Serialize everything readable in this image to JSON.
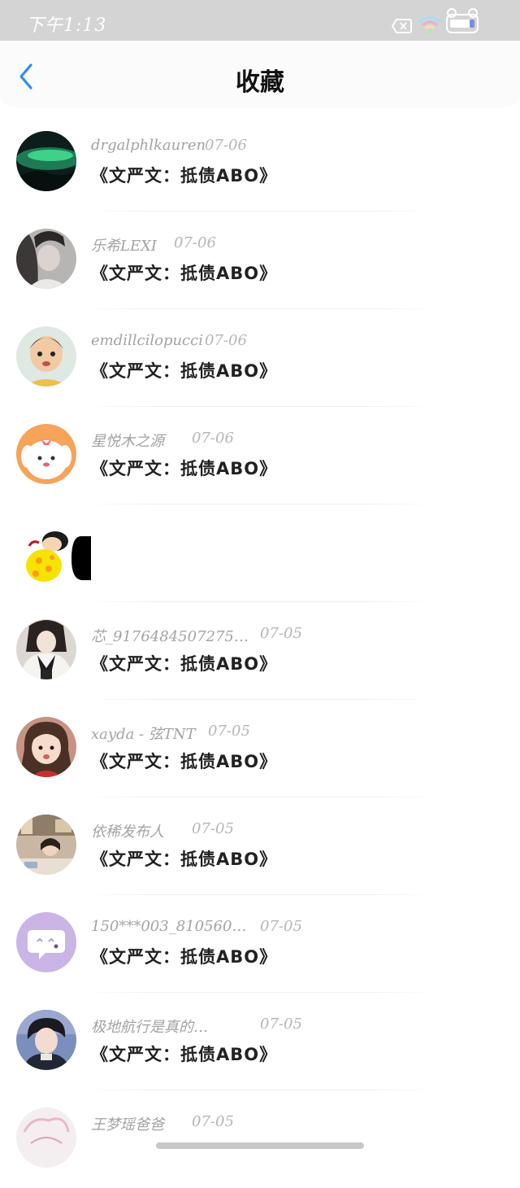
{
  "status_bar": {
    "time": "下午1:13",
    "icons": [
      "sim-absent-icon",
      "wifi-icon",
      "battery-icon"
    ],
    "battery_level": "93"
  },
  "nav": {
    "back_icon": "chevron-left-icon",
    "title": "收藏",
    "accent_color": "#2f8ef0"
  },
  "items": [
    {
      "username": "drgalphlkauren",
      "date": "07-06",
      "title": "《文严文：抵债ABO》",
      "avatar": "aurora"
    },
    {
      "username": "乐希LEXI",
      "date": "07-06",
      "title": "《文严文：抵债ABO》",
      "avatar": "girl-bw"
    },
    {
      "username": "emdillcilopucci",
      "date": "07-06",
      "title": "《文严文：抵债ABO》",
      "avatar": "child"
    },
    {
      "username": "星悦木之源",
      "date": "07-06",
      "title": "《文严文：抵债ABO》",
      "avatar": "cartoon-dog"
    },
    {
      "username": "",
      "date": "",
      "title": "",
      "avatar": "crayon-shin"
    },
    {
      "username": "芯_9176484507275…",
      "date": "07-05",
      "title": "《文严文：抵债ABO》",
      "avatar": "uniform-girl"
    },
    {
      "username": "xayda - 弦TNT",
      "date": "07-05",
      "title": "《文严文：抵债ABO》",
      "avatar": "little-girl"
    },
    {
      "username": "依稀发布人",
      "date": "07-05",
      "title": "《文严文：抵债ABO》",
      "avatar": "room"
    },
    {
      "username": "150***003_810560…",
      "date": "07-05",
      "title": "《文严文：抵债ABO》",
      "avatar": "chat-bubble"
    },
    {
      "username": "极地航行是真的…",
      "date": "07-05",
      "title": "《文严文：抵债ABO》",
      "avatar": "boy"
    },
    {
      "username": "王梦瑶爸爸",
      "date": "07-05",
      "title": "",
      "avatar": "sketch"
    }
  ]
}
